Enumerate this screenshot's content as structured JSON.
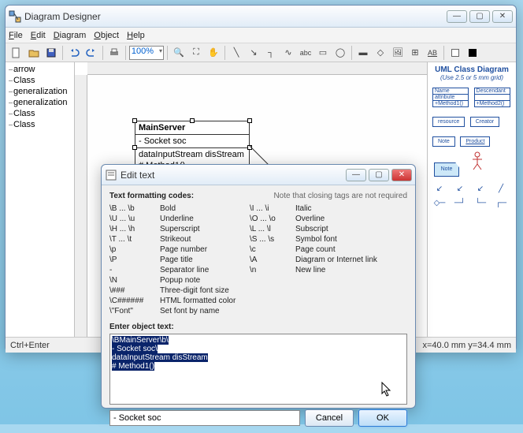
{
  "app": {
    "title": "Diagram Designer"
  },
  "menu": {
    "file": "File",
    "edit": "Edit",
    "diagram": "Diagram",
    "object": "Object",
    "help": "Help"
  },
  "toolbar": {
    "zoom": "100%"
  },
  "tree": {
    "items": [
      "arrow",
      "Class",
      "generalization",
      "generalization",
      "Class",
      "Class"
    ]
  },
  "uml": {
    "name": "MainServer",
    "attr": "- Socket soc",
    "op1": "dataInputStream disStream",
    "op2": "# Method1()"
  },
  "palette": {
    "title": "UML Class Diagram",
    "subtitle": "(Use 2.5 or 5 mm grid)",
    "name_box": "Name",
    "attribute": "attribute",
    "method1": "+Method1()",
    "descendant": "Descendant",
    "method2": "+Method2()",
    "resource": "resource",
    "creator": "Creator",
    "note": "Note",
    "product": "Product",
    "note2": "Note"
  },
  "status": {
    "left": "Ctrl+Enter",
    "right": "x=40.0 mm  y=34.4 mm"
  },
  "dialog": {
    "title": "Edit text",
    "heading": "Text formatting codes:",
    "hint": "Note that closing tags are not required",
    "codes_col1": [
      "\\B ... \\b",
      "\\U ... \\u",
      "\\H ... \\h",
      "\\T ... \\t",
      "\\p",
      "\\P",
      "-",
      "\\N",
      "\\###",
      "\\C######",
      "\\\"Font\""
    ],
    "codes_col2": [
      "Bold",
      "Underline",
      "Superscript",
      "Strikeout",
      "Page number",
      "Page title",
      "Separator line",
      "Popup note",
      "Three-digit font size",
      "HTML formatted color",
      "Set font by name"
    ],
    "codes_col3": [
      "\\I ... \\i",
      "\\O ... \\o",
      "\\L ... \\l",
      "\\S ... \\s",
      "\\c",
      "\\A",
      "\\n",
      "",
      "",
      "",
      ""
    ],
    "codes_col4": [
      "Italic",
      "Overline",
      "Subscript",
      "Symbol font",
      "Page count",
      "Diagram or Internet link",
      "New line",
      "",
      "",
      "",
      ""
    ],
    "enter_label": "Enter object text:",
    "object_text_lines": [
      "\\BMainServer\\b\\",
      "- Socket soc\\",
      "dataInputStream disStream",
      "# Method1()"
    ],
    "footer_input": "- Socket soc",
    "cancel": "Cancel",
    "ok": "OK"
  }
}
